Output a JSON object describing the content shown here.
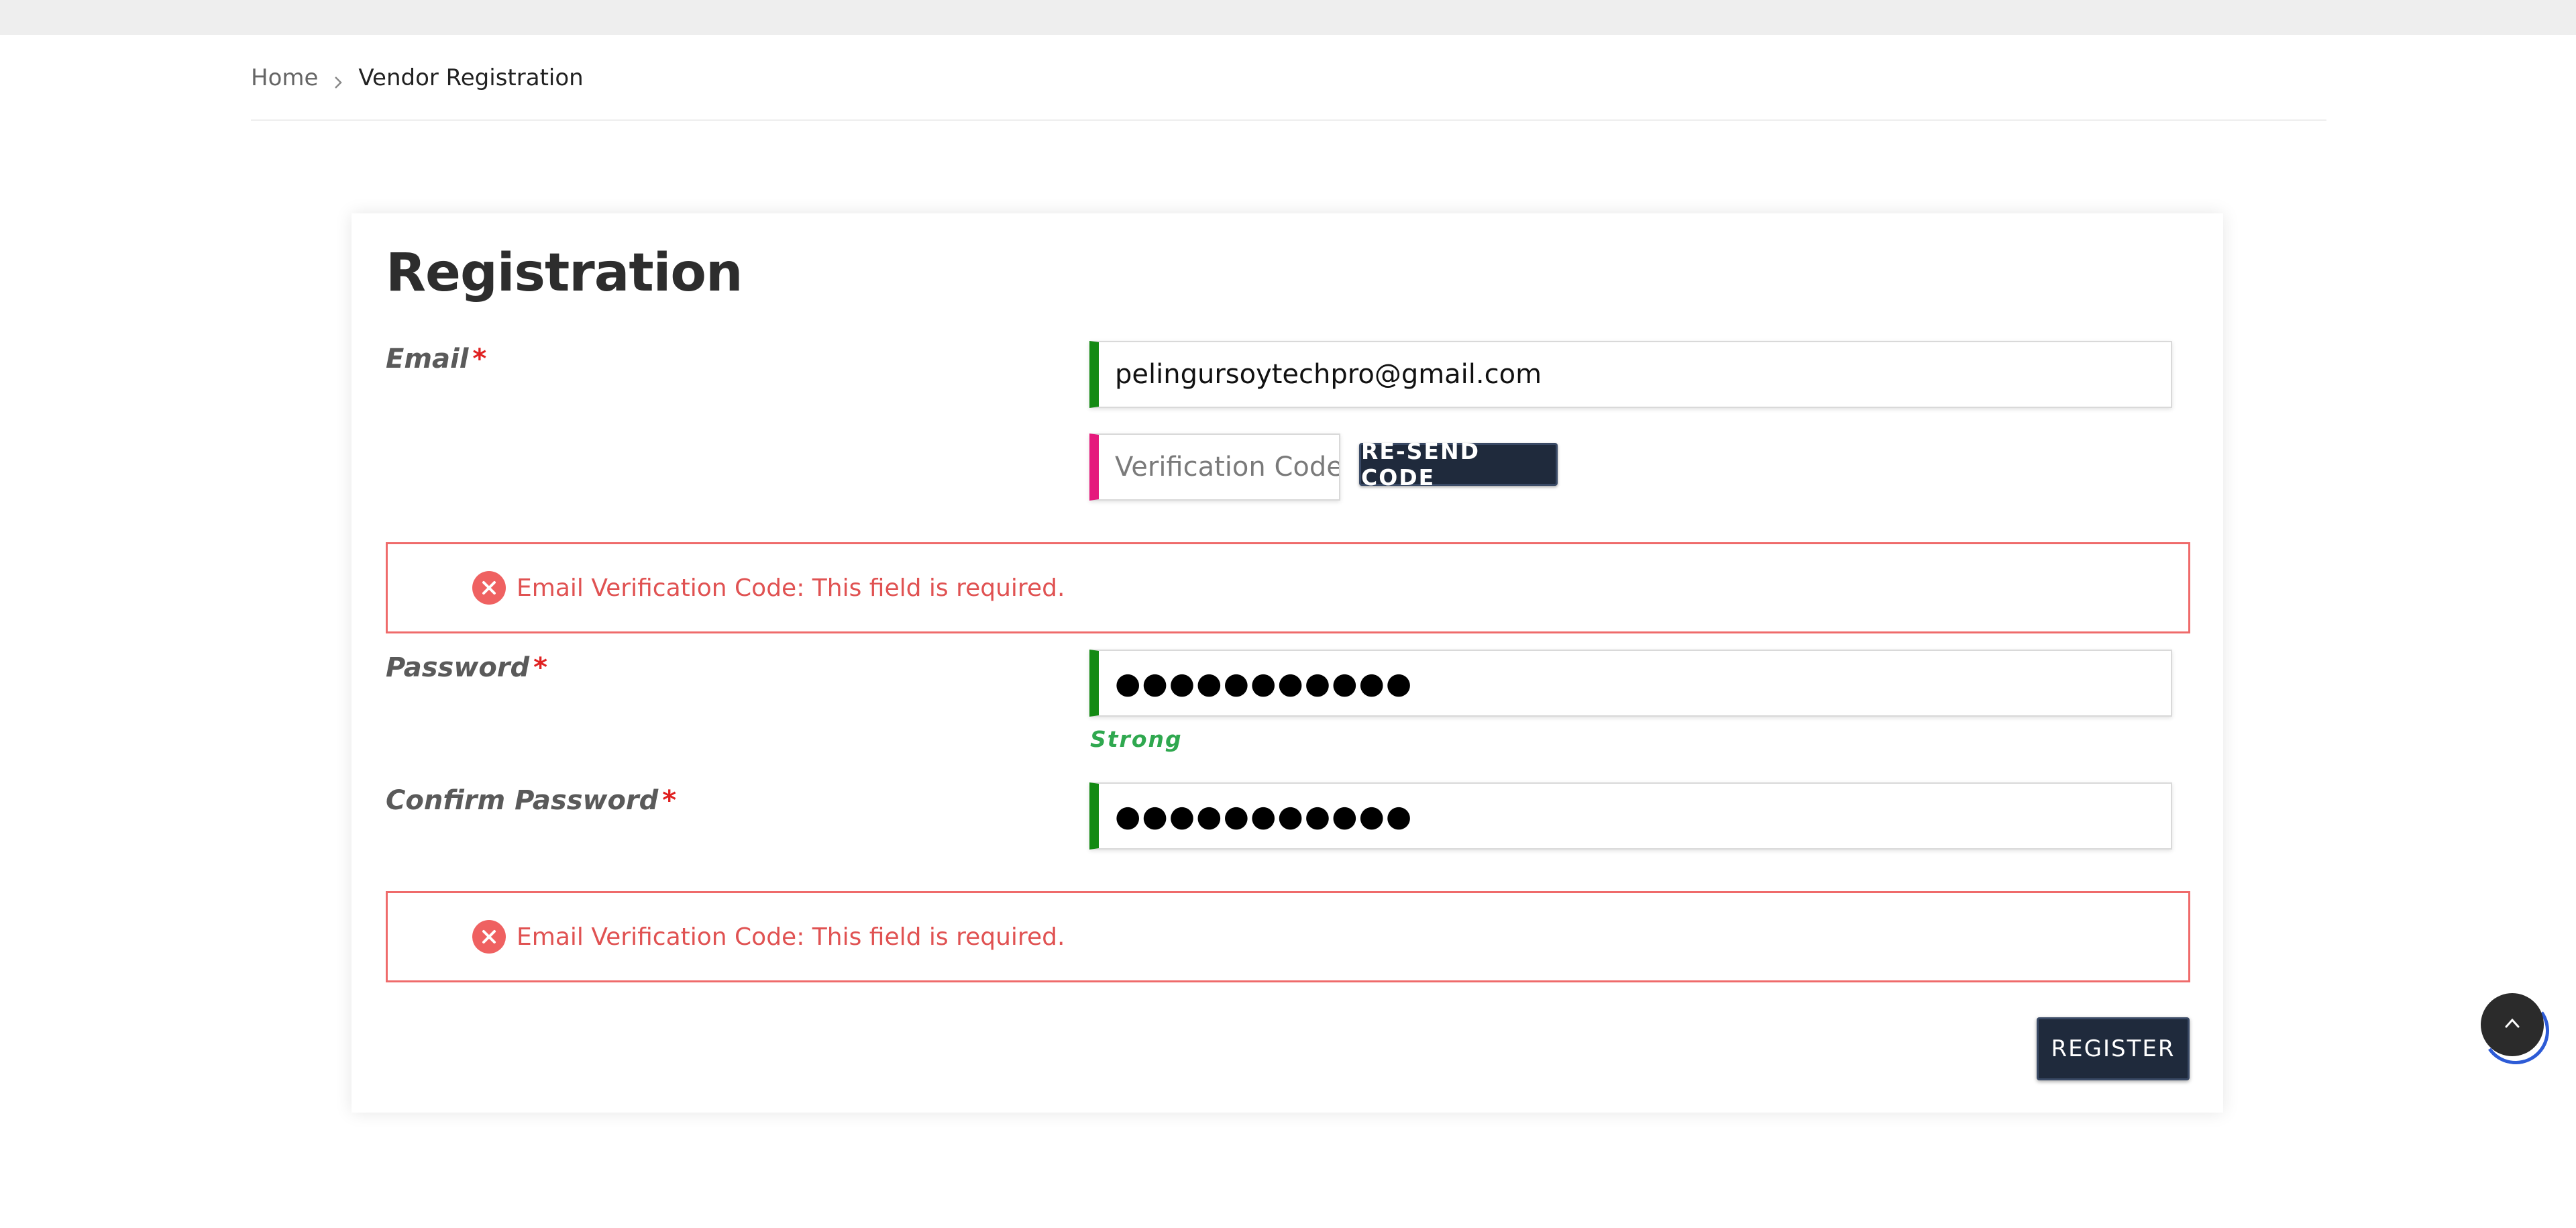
{
  "breadcrumb": {
    "home": "Home",
    "current": "Vendor Registration"
  },
  "form": {
    "title": "Registration",
    "email_label": "Email",
    "required_mark": "*",
    "email_value": "pelingursoytechpro@gmail.com",
    "code_placeholder": "Verification Code",
    "resend_label": "RE-SEND CODE",
    "password_label": "Password",
    "password_mask": "●●●●●●●●●●●",
    "strength": "Strong",
    "confirm_label": "Confirm Password",
    "confirm_mask": "●●●●●●●●●●●",
    "register_label": "REGISTER"
  },
  "errors": [
    "Email Verification Code: This field is required.",
    "Email Verification Code: This field is required."
  ],
  "icons": {
    "breadcrumb_separator": "chevron-right-icon",
    "error": "close-circle-icon",
    "scroll_top": "chevron-up-icon"
  },
  "colors": {
    "valid_bar": "#138a13",
    "pending_bar": "#e5197c",
    "error_text": "#e05252",
    "button_bg": "#1f2a3c",
    "strength_text": "#2fa84f"
  }
}
